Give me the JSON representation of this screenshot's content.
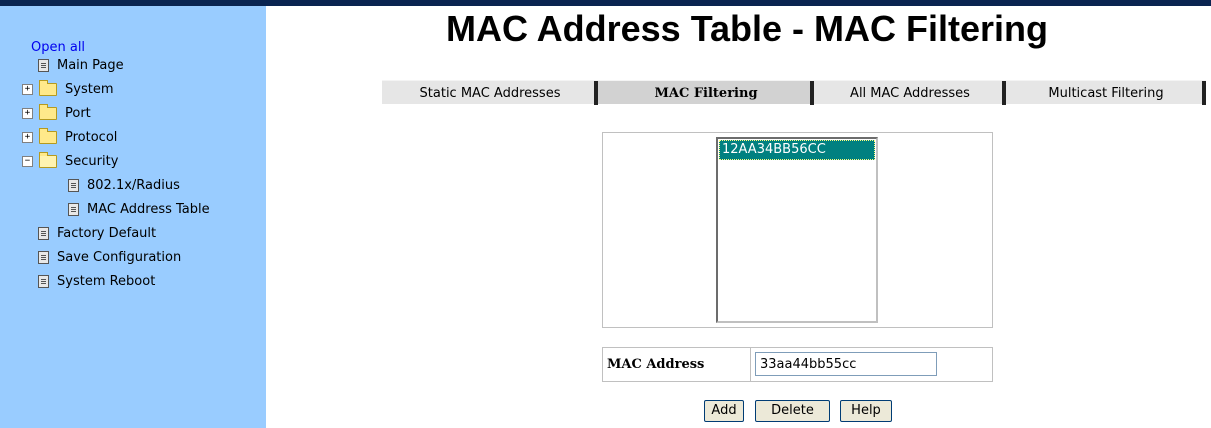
{
  "sidebar": {
    "open_all": "Open all",
    "items": [
      {
        "label": "Main Page",
        "icon": "page-icon"
      },
      {
        "label": "System",
        "icon": "folder-icon",
        "expander": "+"
      },
      {
        "label": "Port",
        "icon": "folder-icon",
        "expander": "+"
      },
      {
        "label": "Protocol",
        "icon": "folder-icon",
        "expander": "+"
      },
      {
        "label": "Security",
        "icon": "folder-open-icon",
        "expander": "−"
      },
      {
        "label": "802.1x/Radius",
        "icon": "page-icon"
      },
      {
        "label": "MAC Address Table",
        "icon": "page-icon"
      },
      {
        "label": "Factory Default",
        "icon": "page-icon"
      },
      {
        "label": "Save Configuration",
        "icon": "page-icon"
      },
      {
        "label": "System Reboot",
        "icon": "page-icon"
      }
    ]
  },
  "header": {
    "title": "MAC Address Table - MAC Filtering"
  },
  "tabs": [
    {
      "label": "Static MAC Addresses"
    },
    {
      "label": "MAC Filtering",
      "active": true
    },
    {
      "label": "All MAC Addresses"
    },
    {
      "label": "Multicast Filtering"
    }
  ],
  "filter_list": {
    "entries": [
      "12AA34BB56CC"
    ]
  },
  "form": {
    "mac_label": "MAC Address",
    "mac_value": "33aa44bb55cc"
  },
  "buttons": {
    "add": "Add",
    "delete": "Delete",
    "help": "Help"
  },
  "colors": {
    "sidebar_bg": "#99ccff",
    "topbar": "#0a2450",
    "selection": "#008080",
    "link": "#0000ee"
  }
}
